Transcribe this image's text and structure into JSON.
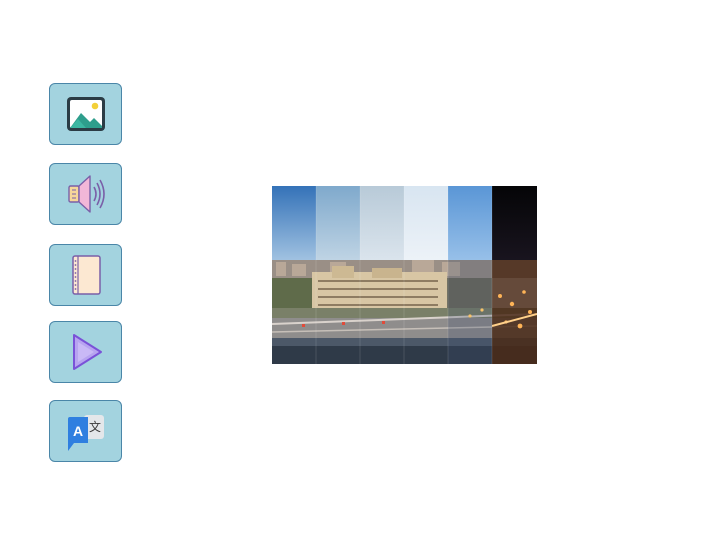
{
  "toolbar": {
    "buttons": [
      {
        "id": "image",
        "icon": "image-icon"
      },
      {
        "id": "audio",
        "icon": "speaker-icon"
      },
      {
        "id": "document",
        "icon": "notebook-icon"
      },
      {
        "id": "video",
        "icon": "play-icon"
      },
      {
        "id": "translate",
        "icon": "translate-icon",
        "glyph_left": "A",
        "glyph_right": "文"
      }
    ]
  },
  "preview": {
    "image": "city-timelapse-strips-photo",
    "strip_count": 6,
    "sky_colors": [
      "#3f7fc0",
      "#8db3d0",
      "#c4d3de",
      "#e4edf4",
      "#6aa2dc",
      "#0d0d12"
    ]
  },
  "colors": {
    "button_fill": "#a3d3df",
    "button_border": "#4a86a8"
  }
}
